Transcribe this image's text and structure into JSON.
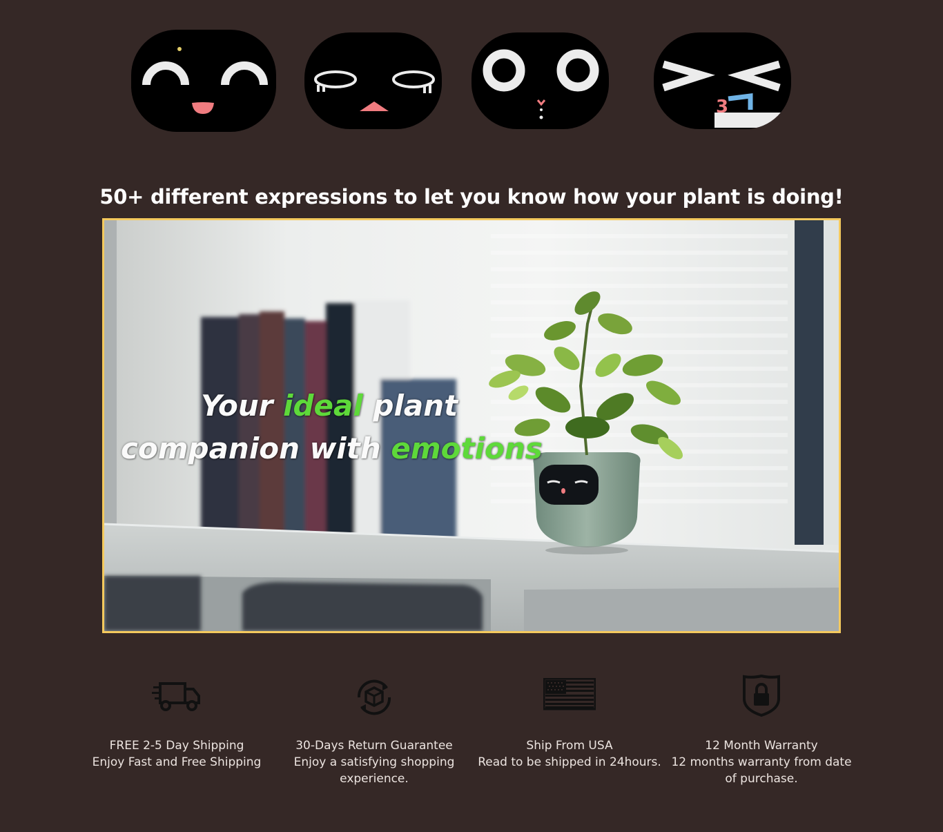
{
  "expressions": [
    {
      "name": "happy-smile"
    },
    {
      "name": "sleepy-drool"
    },
    {
      "name": "surprised"
    },
    {
      "name": "excited-squint"
    }
  ],
  "headline": "50+ different expressions to let you know how your plant is doing!",
  "video": {
    "line1_pre": "Your ",
    "line1_highlight": "ideal",
    "line1_post": " plant",
    "line2_pre": "companion with ",
    "line2_highlight": "emotions",
    "highlight_color": "#5ed93a",
    "border_color": "#f4c95d"
  },
  "features": [
    {
      "icon": "delivery-truck-icon",
      "title": "FREE 2-5 Day Shipping",
      "desc": "Enjoy Fast and Free Shipping"
    },
    {
      "icon": "return-box-icon",
      "title": "30-Days Return Guarantee",
      "desc": "Enjoy a satisfying shopping experience."
    },
    {
      "icon": "usa-flag-icon",
      "title": "Ship From USA",
      "desc": "Read to be shipped in 24hours."
    },
    {
      "icon": "shield-lock-icon",
      "title": "12 Month Warranty",
      "desc": "12 months warranty from date of purchase."
    }
  ],
  "colors": {
    "background": "#352826",
    "text": "#ece4e0"
  }
}
